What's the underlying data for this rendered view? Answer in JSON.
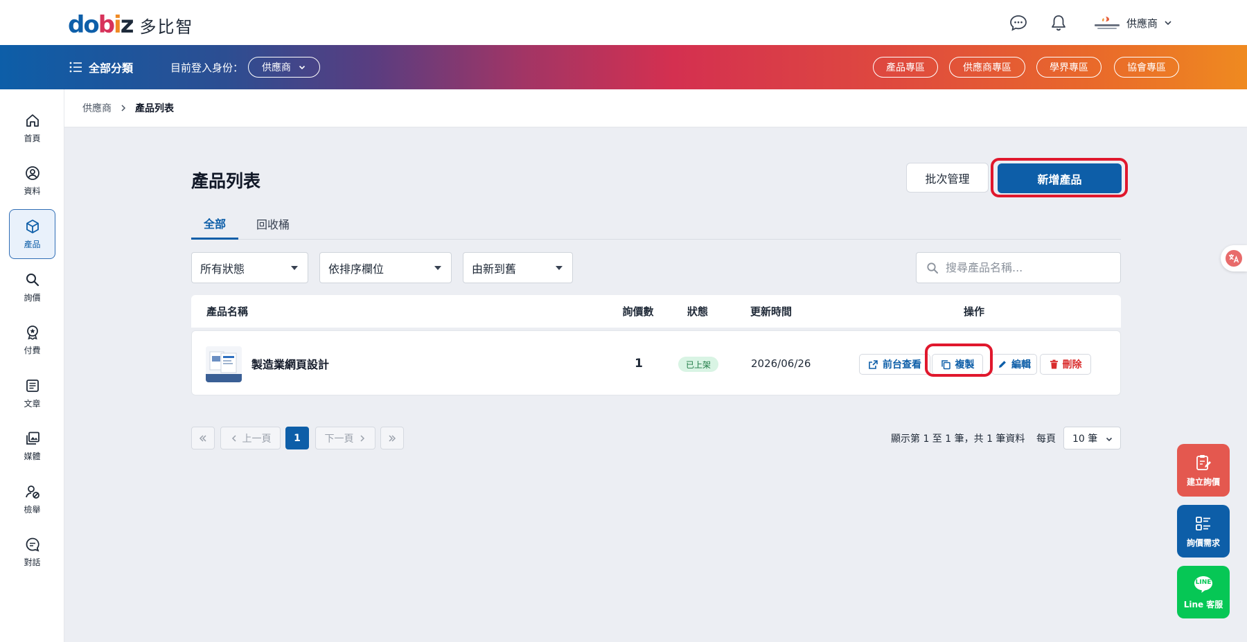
{
  "brand": {
    "logo_text": "多比智",
    "logo_letters": [
      "d",
      "o",
      "b",
      "i",
      "z"
    ]
  },
  "header": {
    "user_name": "供應商"
  },
  "navbar": {
    "category_label": "全部分類",
    "role_label": "目前登入身份：",
    "role_value": "供應商",
    "zones": [
      "產品專區",
      "供應商專區",
      "學界專區",
      "協會專區"
    ]
  },
  "sidebar": {
    "items": [
      {
        "label": "首頁",
        "icon": "home-icon"
      },
      {
        "label": "資料",
        "icon": "user-circle-icon"
      },
      {
        "label": "產品",
        "icon": "box-icon"
      },
      {
        "label": "詢價",
        "icon": "search-icon"
      },
      {
        "label": "付費",
        "icon": "badge-icon"
      },
      {
        "label": "文章",
        "icon": "article-icon"
      },
      {
        "label": "媒體",
        "icon": "media-icon"
      },
      {
        "label": "檢舉",
        "icon": "report-user-icon"
      },
      {
        "label": "對話",
        "icon": "chat-icon"
      }
    ],
    "active_index": 2
  },
  "breadcrumb": {
    "parent": "供應商",
    "current": "產品列表"
  },
  "main": {
    "title": "產品列表",
    "batch_button": "批次管理",
    "new_button": "新增產品",
    "tabs": [
      {
        "label": "全部"
      },
      {
        "label": "回收桶"
      }
    ],
    "filters": {
      "status": "所有狀態",
      "sort_field": "依排序欄位",
      "sort_order": "由新到舊"
    },
    "search_placeholder": "搜尋產品名稱..."
  },
  "table": {
    "headers": [
      "產品名稱",
      "詢價數",
      "狀態",
      "更新時間",
      "操作"
    ],
    "rows": [
      {
        "name": "製造業網頁設計",
        "inquiries": "1",
        "status": "已上架",
        "updated": "2026/06/26",
        "actions": {
          "view": "前台查看",
          "copy": "複製",
          "edit": "編輯",
          "delete": "刪除"
        }
      }
    ]
  },
  "pagination": {
    "prev": "上一頁",
    "next": "下一頁",
    "current_page": "1",
    "summary": "顯示第 1 至 1 筆，共 1 筆資料",
    "per_page_label": "每頁",
    "per_page_value": "10 筆"
  },
  "floating": {
    "create_inquiry": "建立詢價",
    "inquiry_needs": "詢價需求",
    "line_service": "Line 客服",
    "line_badge": "LINE"
  },
  "colors": {
    "primary": "#0d5ea8",
    "highlight": "#e0182d",
    "danger": "#d92d2d",
    "success_bg": "#d9f4e4",
    "float_red": "#e4584f",
    "float_blue": "#0d5ea8",
    "float_green": "#06c755"
  }
}
